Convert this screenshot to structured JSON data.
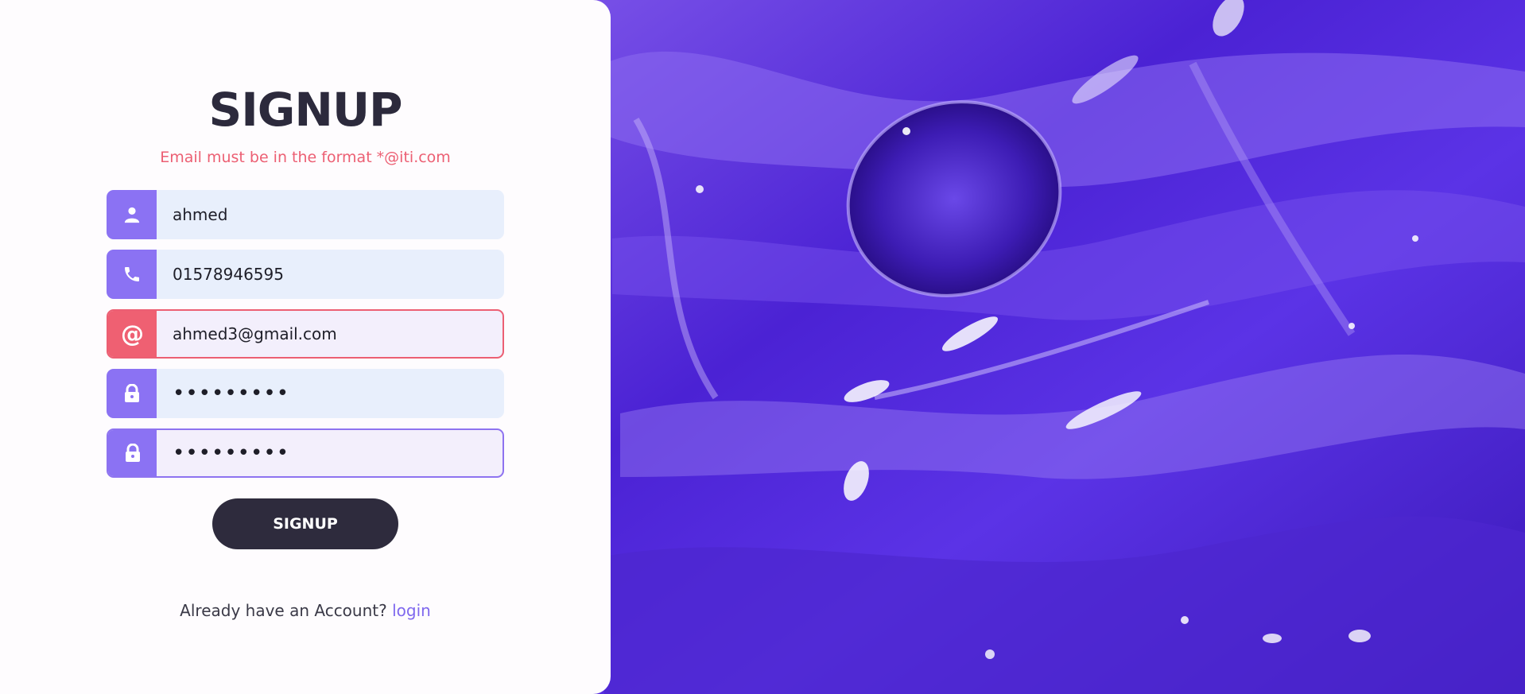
{
  "form": {
    "title": "SIGNUP",
    "error_message": "Email must be in the format *@iti.com",
    "fields": [
      {
        "name": "username",
        "icon": "user-icon",
        "value": "ahmed",
        "state": "default"
      },
      {
        "name": "phone",
        "icon": "phone-icon",
        "value": "01578946595",
        "state": "default"
      },
      {
        "name": "email",
        "icon": "at-icon",
        "icon_glyph": "@",
        "value": "ahmed3@gmail.com",
        "state": "invalid"
      },
      {
        "name": "password",
        "icon": "lock-icon",
        "value": "•••••••••",
        "state": "default"
      },
      {
        "name": "confirm-password",
        "icon": "lock-icon",
        "value": "•••••••••",
        "state": "focused"
      }
    ],
    "submit_label": "SIGNUP",
    "login_prompt": "Already have an Account?",
    "login_link": "login"
  },
  "colors": {
    "icon_bg": "#8b72f3",
    "error": "#ec5f73",
    "button_bg": "#2e2b3d",
    "title": "#2c2a3c",
    "link": "#7f68ee",
    "paint_primary": "#5b2fe0"
  },
  "background": {
    "icon": "purple-paint-texture"
  }
}
